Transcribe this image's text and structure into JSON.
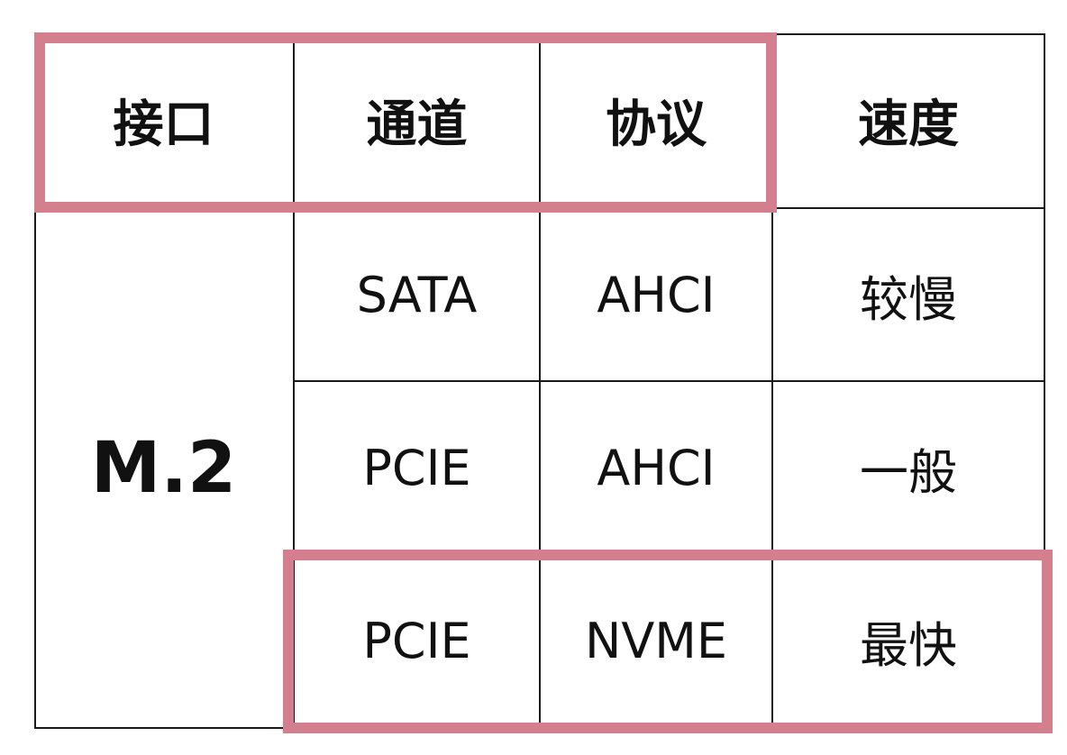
{
  "headers": {
    "interface": "接口",
    "channel": "通道",
    "protocol": "协议",
    "speed": "速度"
  },
  "interface_value": "M.2",
  "rows": [
    {
      "channel": "SATA",
      "protocol": "AHCI",
      "speed": "较慢"
    },
    {
      "channel": "PCIE",
      "protocol": "AHCI",
      "speed": "一般"
    },
    {
      "channel": "PCIE",
      "protocol": "NVME",
      "speed": "最快"
    }
  ],
  "colors": {
    "highlight": "#d47f8d",
    "border": "#1a1a1a",
    "text": "#111111"
  }
}
